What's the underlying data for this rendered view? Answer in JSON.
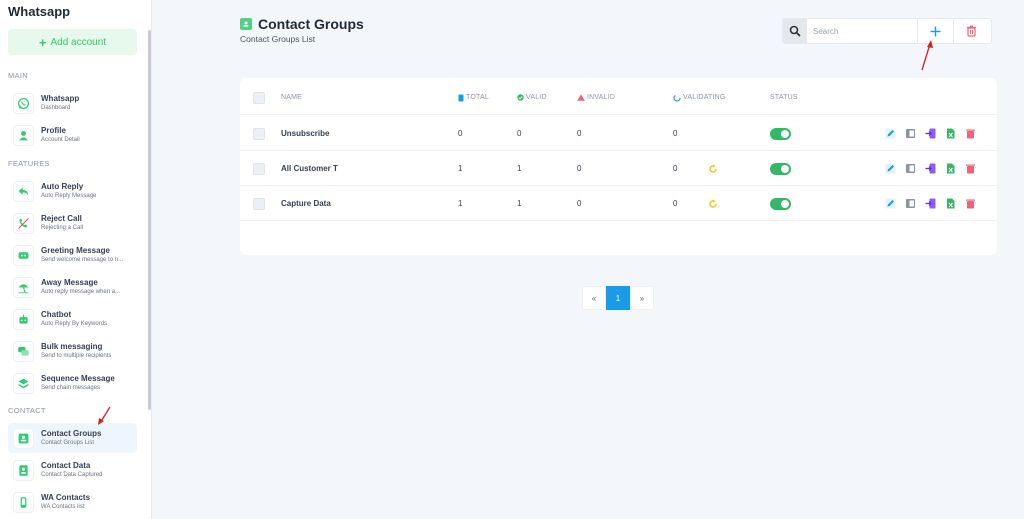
{
  "sidebar": {
    "app_title": "Whatsapp",
    "add_account_label": "Add account",
    "sections": {
      "main": "MAIN",
      "features": "FEATURES",
      "contact": "CONTACT"
    },
    "items": [
      {
        "title": "Whatsapp",
        "subtitle": "Dashboard",
        "icon": "whatsapp-icon"
      },
      {
        "title": "Profile",
        "subtitle": "Account Detail",
        "icon": "user-icon"
      },
      {
        "title": "Auto Reply",
        "subtitle": "Auto Reply Message",
        "icon": "reply-icon"
      },
      {
        "title": "Reject Call",
        "subtitle": "Rejecting a Call",
        "icon": "phone-off-icon"
      },
      {
        "title": "Greeting Message",
        "subtitle": "Send welcome message to n...",
        "icon": "greeting-icon"
      },
      {
        "title": "Away Message",
        "subtitle": "Auto reply message when a...",
        "icon": "beach-umbrella-icon"
      },
      {
        "title": "Chatbot",
        "subtitle": "Auto Reply By Keywords",
        "icon": "robot-icon"
      },
      {
        "title": "Bulk messaging",
        "subtitle": "Send to multiple recipients",
        "icon": "chat-bubbles-icon"
      },
      {
        "title": "Sequence Message",
        "subtitle": "Send chain messages",
        "icon": "layers-icon"
      },
      {
        "title": "Contact Groups",
        "subtitle": "Contact Groups List",
        "icon": "contact-card-icon"
      },
      {
        "title": "Contact Data",
        "subtitle": "Contact Data Captured",
        "icon": "contact-data-icon"
      },
      {
        "title": "WA Contacts",
        "subtitle": "WA Contacts list",
        "icon": "phone-icon"
      }
    ]
  },
  "header": {
    "title": "Contact Groups",
    "subtitle": "Contact Groups List",
    "search_placeholder": "Search"
  },
  "table": {
    "columns": {
      "name": "NAME",
      "total": "TOTAL",
      "valid": "VALID",
      "invalid": "INVALID",
      "validating": "VALIDATING",
      "status": "STATUS"
    },
    "rows": [
      {
        "name": "Unsubscribe",
        "total": "0",
        "valid": "0",
        "invalid": "0",
        "validating": "0",
        "status_on": true,
        "refresh": false
      },
      {
        "name": "All Customer T",
        "total": "1",
        "valid": "1",
        "invalid": "0",
        "validating": "0",
        "status_on": true,
        "refresh": true
      },
      {
        "name": "Capture Data",
        "total": "1",
        "valid": "1",
        "invalid": "0",
        "validating": "0",
        "status_on": true,
        "refresh": true
      }
    ]
  },
  "pagination": {
    "prev": "«",
    "current": "1",
    "next": "»"
  },
  "colors": {
    "brand_green": "#34b766",
    "accent_blue": "#1a9be6",
    "delete_red": "#f0627a"
  }
}
